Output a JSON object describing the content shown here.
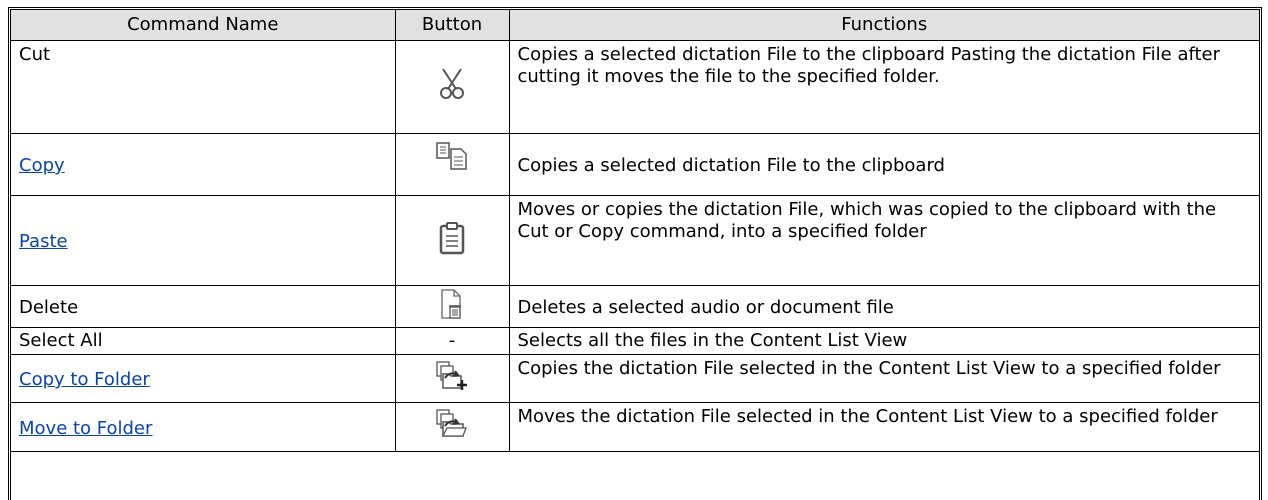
{
  "headers": {
    "command": "Command Name",
    "button": "Button",
    "functions": "Functions"
  },
  "rows": [
    {
      "name": "Cut",
      "link": false,
      "button_icon": "scissors-icon",
      "button_text": "",
      "function": "Copies a selected dictation File to the clipboard Pasting the dictation File after cutting it moves the file to the specified folder."
    },
    {
      "name": "Copy",
      "link": true,
      "button_icon": "copy-icon",
      "button_text": "",
      "function": "Copies a selected dictation File to the clipboard"
    },
    {
      "name": "Paste",
      "link": true,
      "button_icon": "clipboard-icon",
      "button_text": "",
      "function": "Moves or copies the dictation File, which was copied to the clipboard with the Cut or Copy command, into a specified folder"
    },
    {
      "name": "Delete",
      "link": false,
      "button_icon": "delete-file-icon",
      "button_text": "",
      "function": "Deletes a selected audio or document file"
    },
    {
      "name": "Select All",
      "link": false,
      "button_icon": "",
      "button_text": "-",
      "function": "Selects all the files in the Content List View"
    },
    {
      "name": "Copy to Folder",
      "link": true,
      "button_icon": "copy-to-folder-icon",
      "button_text": "",
      "function": "Copies the dictation File selected in the Content List View to a specified folder"
    },
    {
      "name": "Move to Folder",
      "link": true,
      "button_icon": "move-to-folder-icon",
      "button_text": "",
      "function": "Moves the dictation File selected in the Content List View to a specified folder"
    }
  ]
}
